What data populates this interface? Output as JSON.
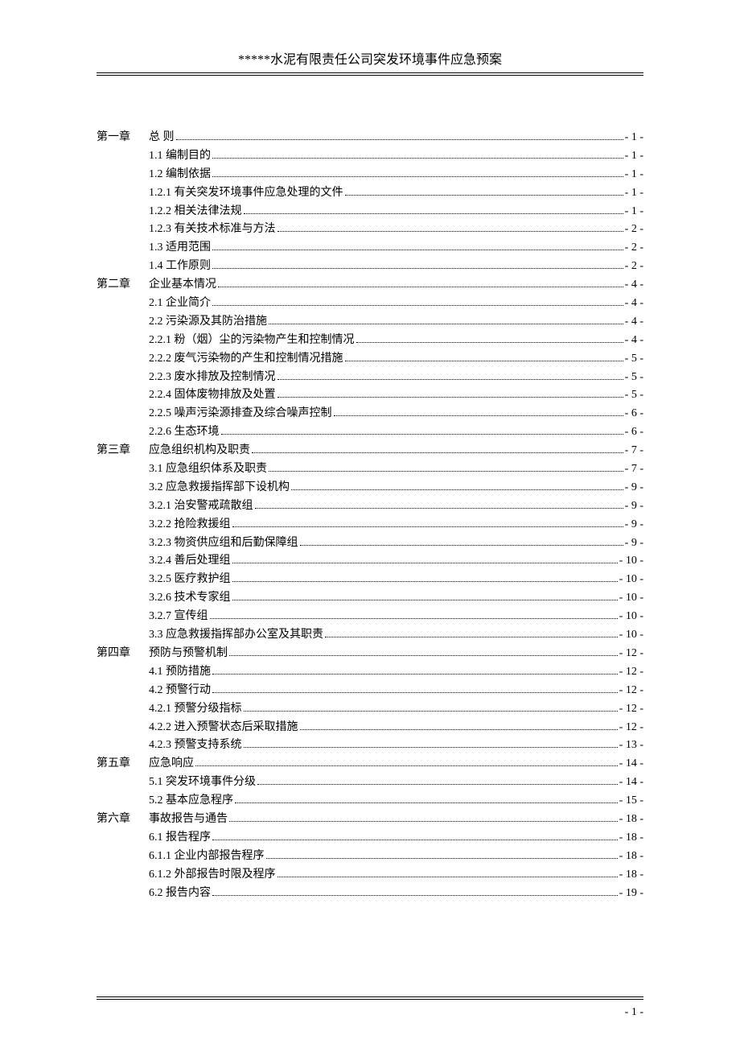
{
  "header": {
    "title": "*****水泥有限责任公司突发环境事件应急预案"
  },
  "footer": {
    "page": "- 1 -"
  },
  "toc": [
    {
      "chapter": "第一章",
      "title": "总 则",
      "page": "- 1 -"
    },
    {
      "title": "1.1  编制目的",
      "page": "- 1 -"
    },
    {
      "title": "1.2  编制依据",
      "page": "- 1 -"
    },
    {
      "title": "1.2.1 有关突发环境事件应急处理的文件",
      "page": "- 1 -"
    },
    {
      "title": "1.2.2  相关法律法规",
      "page": "- 1 -"
    },
    {
      "title": "1.2.3 有关技术标准与方法",
      "page": "- 2 -"
    },
    {
      "title": "1.3  适用范围",
      "page": "- 2 -"
    },
    {
      "title": "1.4 工作原则",
      "page": "- 2 -"
    },
    {
      "chapter": "第二章",
      "title": "企业基本情况",
      "page": "- 4 -"
    },
    {
      "title": "2.1 企业简介",
      "page": "- 4 -"
    },
    {
      "title": "2.2 污染源及其防治措施",
      "page": "- 4 -"
    },
    {
      "title": "2.2.1 粉（烟）尘的污染物产生和控制情况",
      "page": "- 4 -"
    },
    {
      "title": "2.2.2 废气污染物的产生和控制情况措施",
      "page": "- 5 -"
    },
    {
      "title": "2.2.3 废水排放及控制情况",
      "page": "- 5 -"
    },
    {
      "title": "2.2.4 固体废物排放及处置",
      "page": "- 5 -"
    },
    {
      "title": "2.2.5 噪声污染源排查及综合噪声控制",
      "page": "- 6 -"
    },
    {
      "title": "2.2.6 生态环境",
      "page": "- 6 -"
    },
    {
      "chapter": "第三章",
      "title": "应急组织机构及职责",
      "page": "- 7 -"
    },
    {
      "title": "3.1 应急组织体系及职责",
      "page": "- 7 -"
    },
    {
      "title": "3.2 应急救援指挥部下设机构",
      "page": "- 9 -"
    },
    {
      "title": "3.2.1 治安警戒疏散组",
      "page": "- 9 -"
    },
    {
      "title": "3.2.2 抢险救援组",
      "page": "- 9 -"
    },
    {
      "title": "3.2.3 物资供应组和后勤保障组",
      "page": "- 9 -"
    },
    {
      "title": "3.2.4 善后处理组",
      "page": "- 10 -"
    },
    {
      "title": "3.2.5 医疗救护组",
      "page": "- 10 -"
    },
    {
      "title": "3.2.6 技术专家组",
      "page": "- 10 -"
    },
    {
      "title": "3.2.7 宣传组",
      "page": "- 10 -"
    },
    {
      "title": "3.3  应急救援指挥部办公室及其职责",
      "page": "- 10 -"
    },
    {
      "chapter": "第四章",
      "title": "预防与预警机制",
      "page": "- 12 -"
    },
    {
      "title": "4.1  预防措施",
      "page": "- 12 -"
    },
    {
      "title": "4.2 预警行动",
      "page": "- 12 -"
    },
    {
      "title": "4.2.1  预警分级指标",
      "page": "- 12 -"
    },
    {
      "title": "4.2.2 进入预警状态后采取措施",
      "page": "- 12 -"
    },
    {
      "title": "4.2.3 预警支持系统",
      "page": "- 13 -"
    },
    {
      "chapter": "第五章",
      "title": "应急响应",
      "page": "- 14 -"
    },
    {
      "title": "5.1 突发环境事件分级",
      "page": "- 14 -"
    },
    {
      "title": "5.2 基本应急程序",
      "page": "- 15 -"
    },
    {
      "chapter": "第六章",
      "title": "事故报告与通告",
      "page": "- 18 -"
    },
    {
      "title": "6.1 报告程序",
      "page": "- 18 -"
    },
    {
      "title": "6.1.1 企业内部报告程序",
      "page": "- 18 -"
    },
    {
      "title": "6.1.2 外部报告时限及程序",
      "page": "- 18 -"
    },
    {
      "title": "6.2 报告内容",
      "page": "- 19 -"
    }
  ]
}
